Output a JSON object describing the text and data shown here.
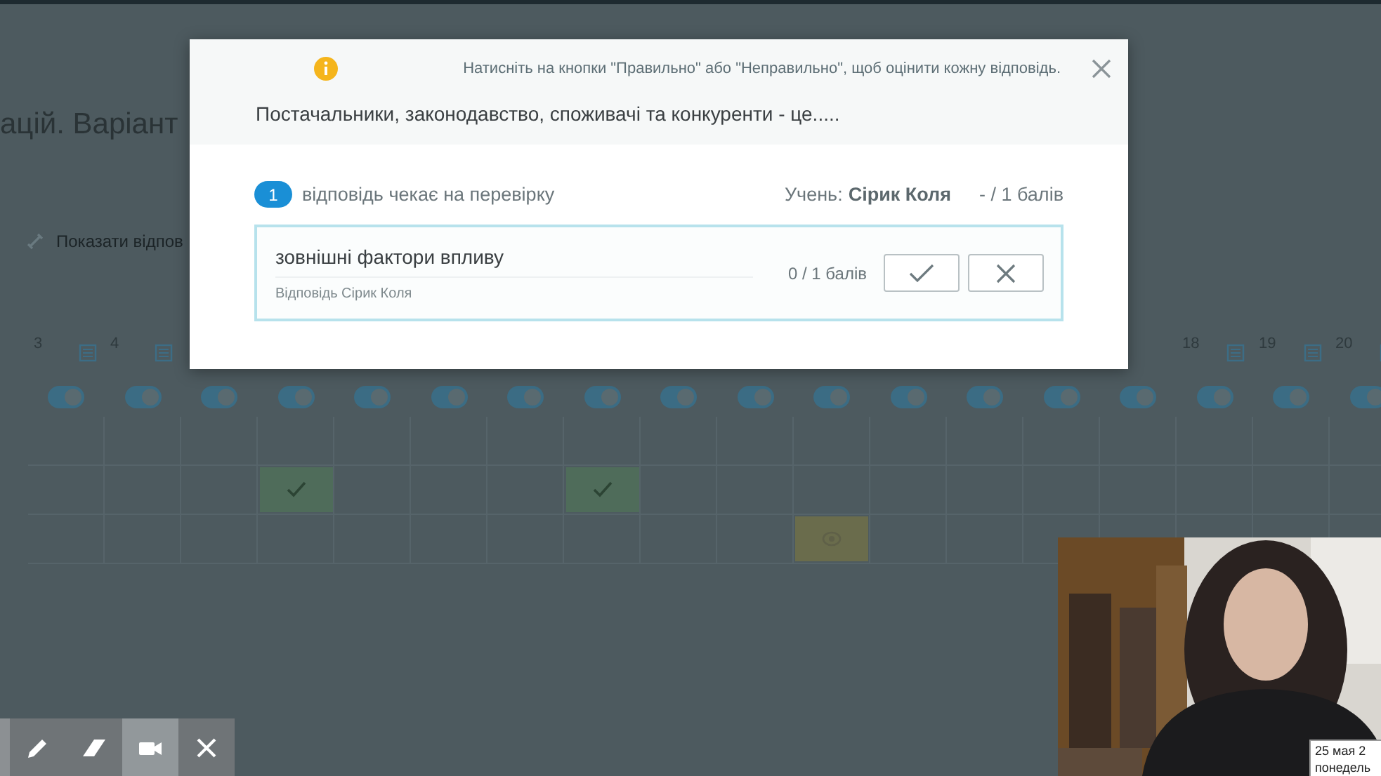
{
  "page": {
    "title": "ацій. Варіант",
    "show_answers": "Показати відпов",
    "columns": [
      {
        "number": "3",
        "on": true
      },
      {
        "number": "4",
        "on": true
      },
      {
        "on": true
      },
      {
        "on": true
      },
      {
        "on": true
      },
      {
        "on": true
      },
      {
        "on": true
      },
      {
        "on": true
      },
      {
        "on": true
      },
      {
        "on": true
      },
      {
        "on": true
      },
      {
        "on": true
      },
      {
        "on": true
      },
      {
        "on": true
      },
      {
        "on": true
      },
      {
        "number": "18",
        "on": true
      },
      {
        "number": "19",
        "on": true
      },
      {
        "number": "20",
        "on": true
      }
    ],
    "rows": [
      {
        "cells": [
          {
            "kind": "empty"
          },
          {
            "kind": "empty"
          },
          {
            "kind": "empty"
          },
          {
            "kind": "empty"
          },
          {
            "kind": "empty"
          },
          {
            "kind": "empty"
          },
          {
            "kind": "empty"
          },
          {
            "kind": "empty"
          },
          {
            "kind": "empty"
          },
          {
            "kind": "empty"
          },
          {
            "kind": "empty"
          },
          {
            "kind": "empty"
          },
          {
            "kind": "empty"
          },
          {
            "kind": "empty"
          },
          {
            "kind": "empty"
          },
          {
            "kind": "empty"
          },
          {
            "kind": "empty"
          },
          {
            "kind": "empty"
          }
        ]
      },
      {
        "cells": [
          {
            "kind": "empty"
          },
          {
            "kind": "empty"
          },
          {
            "kind": "empty"
          },
          {
            "kind": "correct"
          },
          {
            "kind": "empty"
          },
          {
            "kind": "empty"
          },
          {
            "kind": "empty"
          },
          {
            "kind": "correct"
          },
          {
            "kind": "empty"
          },
          {
            "kind": "empty"
          },
          {
            "kind": "empty"
          },
          {
            "kind": "empty"
          },
          {
            "kind": "empty"
          },
          {
            "kind": "empty"
          },
          {
            "kind": "empty"
          },
          {
            "kind": "empty"
          },
          {
            "kind": "empty"
          },
          {
            "kind": "empty"
          }
        ]
      },
      {
        "cells": [
          {
            "kind": "empty"
          },
          {
            "kind": "empty"
          },
          {
            "kind": "empty"
          },
          {
            "kind": "empty"
          },
          {
            "kind": "empty"
          },
          {
            "kind": "empty"
          },
          {
            "kind": "empty"
          },
          {
            "kind": "empty"
          },
          {
            "kind": "empty"
          },
          {
            "kind": "empty"
          },
          {
            "kind": "pending"
          },
          {
            "kind": "empty"
          },
          {
            "kind": "empty"
          },
          {
            "kind": "empty"
          },
          {
            "kind": "empty"
          },
          {
            "kind": "empty"
          },
          {
            "kind": "empty"
          },
          {
            "kind": "empty"
          }
        ]
      }
    ]
  },
  "dialog": {
    "hint": "Натисніть на кнопки \"Правильно\" або \"Неправильно\", щоб оцінити кожну відповідь.",
    "question": "Постачальники, законодавство, споживачі та конкуренти - це.....",
    "pending_count": "1",
    "pending_label": "відповідь чекає на перевірку",
    "student_label": "Учень:",
    "student_name": "Сірик Коля",
    "score": "- / 1 балів",
    "answers": [
      {
        "text": "зовнішні фактори впливу",
        "author": "Відповідь Сірик Коля",
        "score": "0 / 1 балів"
      }
    ]
  },
  "toolbar": [
    {
      "kind": "pencil",
      "selected": false
    },
    {
      "kind": "eraser",
      "selected": false
    },
    {
      "kind": "camera",
      "selected": true
    },
    {
      "kind": "close",
      "selected": false
    }
  ],
  "webcam": {
    "kind": "picture"
  },
  "clock": [
    "25 мая 2",
    "понедель"
  ]
}
